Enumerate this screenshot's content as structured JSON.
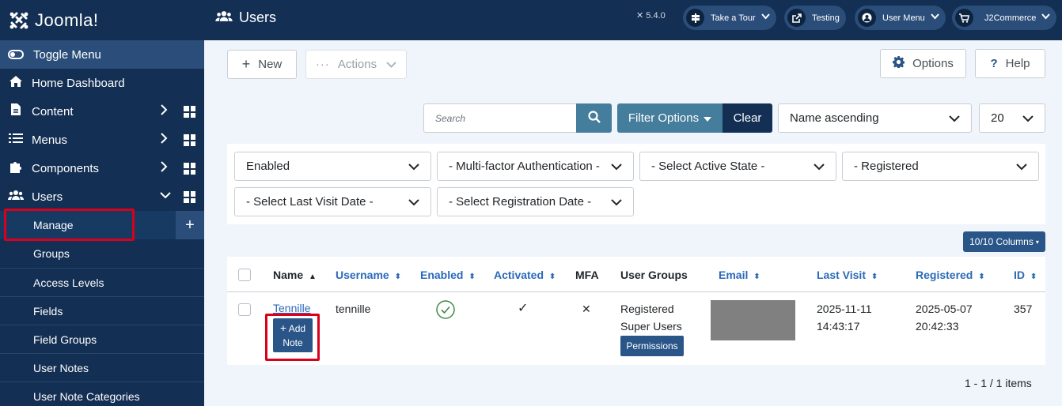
{
  "sidebar": {
    "logo_text": "Joomla!",
    "toggle_menu": "Toggle Menu",
    "items": [
      {
        "label": "Home Dashboard",
        "icon": "home-icon"
      },
      {
        "label": "Content",
        "icon": "file-icon"
      },
      {
        "label": "Menus",
        "icon": "list-icon"
      },
      {
        "label": "Components",
        "icon": "puzzle-icon"
      },
      {
        "label": "Users",
        "icon": "users-icon"
      }
    ],
    "sub_items": [
      "Manage",
      "Groups",
      "Access Levels",
      "Fields",
      "Field Groups",
      "User Notes",
      "User Note Categories"
    ],
    "manage_add": "+"
  },
  "header": {
    "title": "Users",
    "version": "5.4.0",
    "take_tour": "Take a Tour",
    "testing": "Testing",
    "user_menu": "User Menu",
    "j2commerce": "J2Commerce"
  },
  "toolbar": {
    "new_label": "New",
    "actions_label": "Actions",
    "options_label": "Options",
    "help_label": "Help"
  },
  "search": {
    "placeholder": "Search",
    "filter_options": "Filter Options",
    "clear": "Clear",
    "ordering": "Name ascending",
    "limit": "20"
  },
  "filters": {
    "state": "Enabled",
    "mfa": "- Multi-factor Authentication -",
    "active": "- Select Active State -",
    "group": "- Registered",
    "last_visit": "- Select Last Visit Date -",
    "registration": "- Select Registration Date -"
  },
  "columns_button": "10/10 Columns",
  "table": {
    "headers": {
      "name": "Name",
      "username": "Username",
      "enabled": "Enabled",
      "activated": "Activated",
      "mfa": "MFA",
      "user_groups": "User Groups",
      "email": "Email",
      "last_visit": "Last Visit",
      "registered": "Registered",
      "id": "ID"
    },
    "row": {
      "name": "Tennille",
      "add_note": "Add Note",
      "username": "tennille",
      "enabled": "✓",
      "activated": "✓",
      "mfa": "✕",
      "group_1": "Registered",
      "group_2": "Super Users",
      "permissions": "Permissions",
      "last_visit_date": "2025-11-11",
      "last_visit_time": "14:43:17",
      "registered_date": "2025-05-07",
      "registered_time": "20:42:33",
      "id": "357"
    }
  },
  "pagination": "1 - 1 / 1 items",
  "colors": {
    "sidebar_bg": "#132f53",
    "accent": "#457d9c",
    "button_dark": "#2a5588",
    "highlight": "#d9001b"
  }
}
